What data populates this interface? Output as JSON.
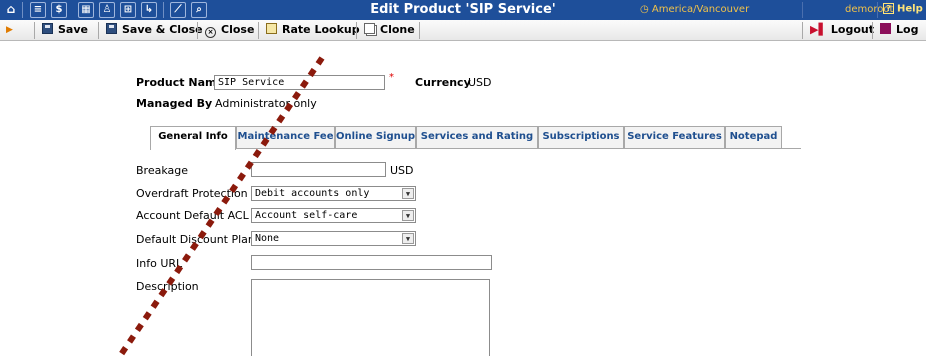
{
  "header": {
    "title": "Edit Product 'SIP Service'",
    "timezone": "America/Vancouver",
    "user": "demoroot",
    "help_label": "Help",
    "icons": [
      "home-icon",
      "list-icon",
      "dollar-icon",
      "grid-icon",
      "person-icon",
      "network-icon",
      "import-icon",
      "chart-icon",
      "search-icon"
    ]
  },
  "toolbar": {
    "save": "Save",
    "save_close": "Save & Close",
    "close": "Close",
    "rate_lookup": "Rate Lookup",
    "clone": "Clone",
    "logout": "Logout",
    "log": "Log"
  },
  "product": {
    "name_label": "Product Name",
    "name_value": "SIP Service",
    "currency_label": "Currency",
    "currency_value": "USD",
    "managed_label": "Managed By",
    "managed_value": "Administrator only"
  },
  "tabs": [
    {
      "label": "General Info",
      "active": true
    },
    {
      "label": "Maintenance Fee"
    },
    {
      "label": "Online Signup"
    },
    {
      "label": "Services and Rating"
    },
    {
      "label": "Subscriptions"
    },
    {
      "label": "Service Features"
    },
    {
      "label": "Notepad"
    }
  ],
  "form": {
    "breakage_label": "Breakage",
    "breakage_value": "",
    "breakage_unit": "USD",
    "overdraft_label": "Overdraft Protection",
    "overdraft_value": "Debit accounts only",
    "acl_label": "Account Default ACL",
    "acl_value": "Account self-care",
    "discount_label": "Default Discount Plan",
    "discount_value": "None",
    "info_url_label": "Info URL",
    "info_url_value": "",
    "description_label": "Description",
    "description_value": ""
  }
}
